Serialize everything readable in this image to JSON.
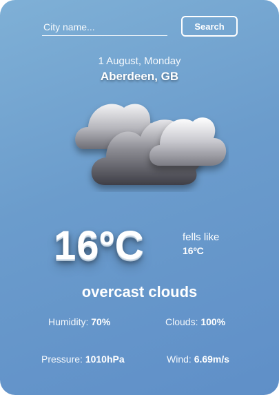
{
  "search": {
    "placeholder": "City name...",
    "button_label": "Search"
  },
  "header": {
    "date": "1 August, Monday",
    "location": "Aberdeen, GB"
  },
  "weather": {
    "icon": "overcast-clouds-icon",
    "temperature": "16ºC",
    "feels_like_label": "fells like",
    "feels_like_value": "16ºC",
    "description": "overcast clouds"
  },
  "stats": {
    "humidity_label": "Humidity:",
    "humidity_value": "70%",
    "clouds_label": "Clouds:",
    "clouds_value": "100%",
    "pressure_label": "Pressure:",
    "pressure_value": "1010hPa",
    "wind_label": "Wind:",
    "wind_value": "6.69m/s"
  },
  "colors": {
    "card_gradient_start": "#7fb0d6",
    "card_gradient_end": "#5f8fc8",
    "text": "#ffffff"
  }
}
